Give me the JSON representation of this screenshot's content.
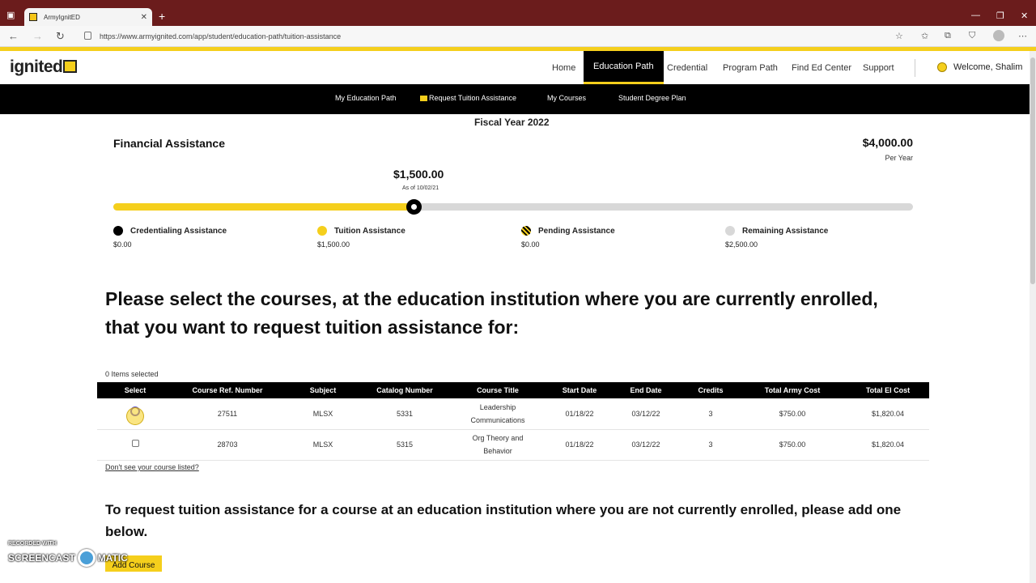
{
  "browser": {
    "tab_title": "ArmyIgnitED",
    "tab_close": "✕",
    "new_tab": "+",
    "url": "https://www.armyignited.com/app/student/education-path/tuition-assistance",
    "window_controls": [
      "—",
      "❐",
      "✕"
    ]
  },
  "site": {
    "logo_text": "ignited",
    "nav": [
      "Home",
      "Education Path",
      "Credential",
      "Program Path",
      "Find Ed Center",
      "Support"
    ],
    "active_nav": "Education Path",
    "welcome": "Welcome, Shalim",
    "subnav": [
      "My Education Path",
      "Request Tuition Assistance",
      "My Courses",
      "Student Degree Plan"
    ]
  },
  "financial": {
    "fiscal_year": "Fiscal Year 2022",
    "title": "Financial Assistance",
    "max_amount": "$4,000.00",
    "per_year": "Per Year",
    "current_amount": "$1,500.00",
    "as_of": "As of 10/02/21",
    "progress_fraction": 0.375,
    "legend": [
      {
        "label": "Credentialing Assistance",
        "value": "$0.00",
        "color": "#000000"
      },
      {
        "label": "Tuition Assistance",
        "value": "$1,500.00",
        "color": "#f5cf1c"
      },
      {
        "label": "Pending Assistance",
        "value": "$0.00",
        "color": "striped"
      },
      {
        "label": "Remaining Assistance",
        "value": "$2,500.00",
        "color": "#d8d8d8"
      }
    ]
  },
  "courses": {
    "instruction": "Please select the courses, at the education institution where you are currently enrolled, that you want to request tuition assistance for:",
    "items_selected": "0 Items selected",
    "columns": [
      "Select",
      "Course Ref. Number",
      "Subject",
      "Catalog Number",
      "Course Title",
      "Start Date",
      "End Date",
      "Credits",
      "Total Army Cost",
      "Total EI Cost"
    ],
    "rows": [
      {
        "ref": "27511",
        "subject": "MLSX",
        "catalog": "5331",
        "title_1": "Leadership",
        "title_2": "Communications",
        "start": "01/18/22",
        "end": "03/12/22",
        "credits": "3",
        "army_cost": "$750.00",
        "ei_cost": "$1,820.04"
      },
      {
        "ref": "28703",
        "subject": "MLSX",
        "catalog": "5315",
        "title_1": "Org Theory and",
        "title_2": "Behavior",
        "start": "01/18/22",
        "end": "03/12/22",
        "credits": "3",
        "army_cost": "$750.00",
        "ei_cost": "$1,820.04"
      }
    ],
    "missing_link": "Don't see your course listed?"
  },
  "add_section": {
    "instruction": "To request tuition assistance for a course at an education institution where you are not currently enrolled, please add one below.",
    "button": "Add Course"
  },
  "watermark": {
    "top": "RECORDED WITH",
    "left": "SCREENCAST",
    "right": "MATIC"
  },
  "colors": {
    "accent": "#f5cf1c",
    "tabbar": "#6b1c1c",
    "nav_bg": "#000000"
  }
}
